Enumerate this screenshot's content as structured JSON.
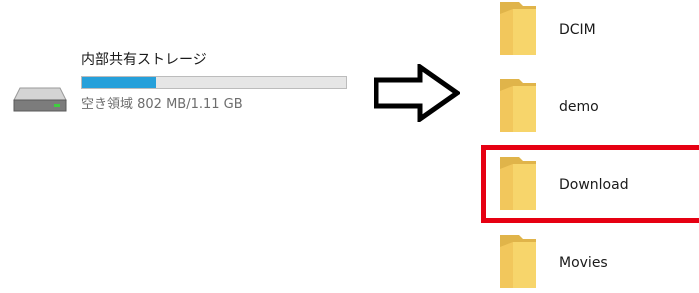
{
  "drive": {
    "name": "内部共有ストレージ",
    "free_text": "空き領域 802 MB/1.11 GB",
    "usage_fraction": 0.28,
    "icon": "hard-drive-icon",
    "bar_color": "#26a0da"
  },
  "folders": [
    {
      "label": "DCIM",
      "icon": "folder-icon"
    },
    {
      "label": "demo",
      "icon": "folder-icon"
    },
    {
      "label": "Download",
      "icon": "folder-icon",
      "highlighted": true
    },
    {
      "label": "Movies",
      "icon": "folder-icon"
    }
  ],
  "colors": {
    "folder": "#f7d56b",
    "highlight": "#e60012",
    "arrow": "#000000"
  }
}
